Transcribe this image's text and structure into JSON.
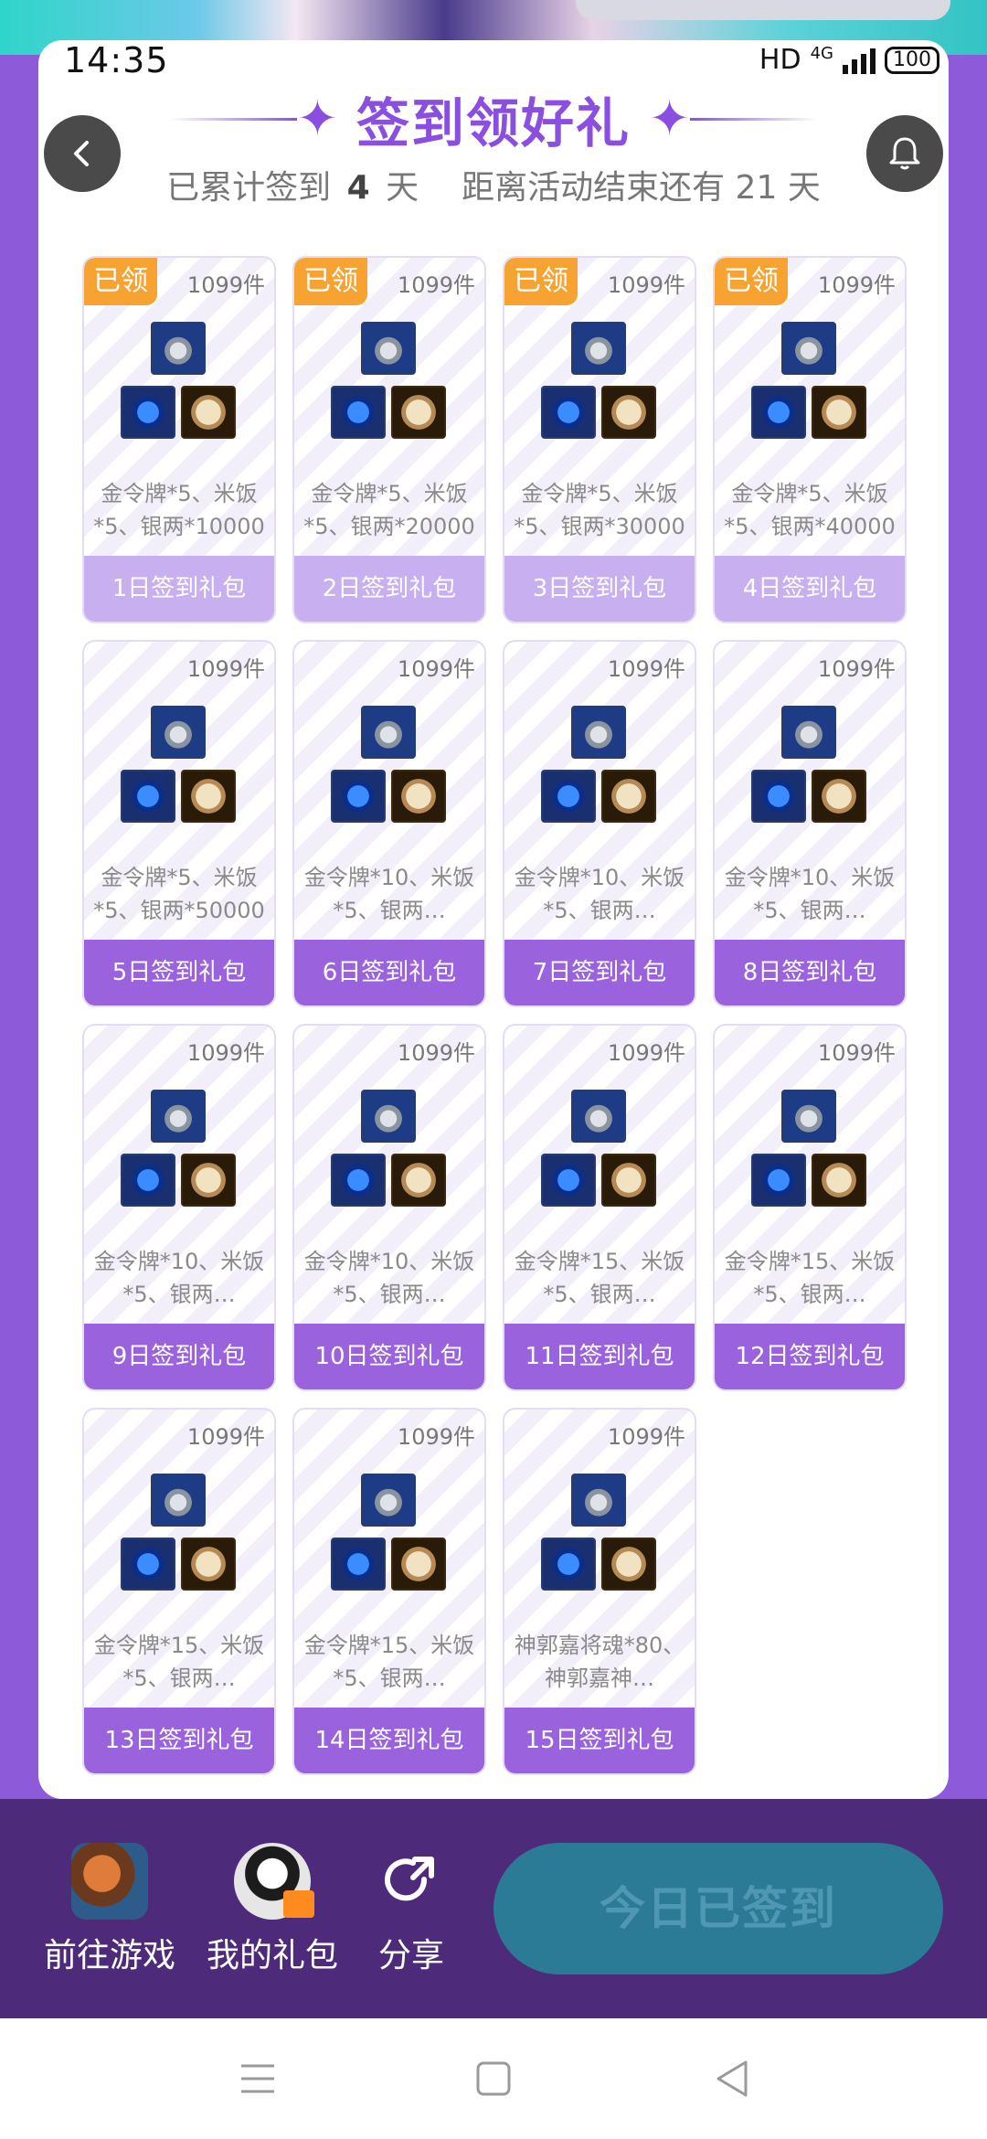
{
  "status_bar": {
    "time": "14:35",
    "network": "HD",
    "signal_type": "4G",
    "battery": "100"
  },
  "header": {
    "title": "签到领好礼",
    "subtitle_prefix": "已累计签到",
    "signed_days": "4",
    "day_unit": "天",
    "remaining_prefix": "距离活动结束还有",
    "remaining_days": "21",
    "remaining_unit": "天"
  },
  "claimed_label": "已领",
  "gifts": [
    {
      "count": "1099件",
      "desc": "金令牌*5、米饭*5、银两*10000",
      "label": "1日签到礼包",
      "claimed": true
    },
    {
      "count": "1099件",
      "desc": "金令牌*5、米饭*5、银两*20000",
      "label": "2日签到礼包",
      "claimed": true
    },
    {
      "count": "1099件",
      "desc": "金令牌*5、米饭*5、银两*30000",
      "label": "3日签到礼包",
      "claimed": true
    },
    {
      "count": "1099件",
      "desc": "金令牌*5、米饭*5、银两*40000",
      "label": "4日签到礼包",
      "claimed": true
    },
    {
      "count": "1099件",
      "desc": "金令牌*5、米饭*5、银两*50000",
      "label": "5日签到礼包",
      "claimed": false
    },
    {
      "count": "1099件",
      "desc": "金令牌*10、米饭*5、银两…",
      "label": "6日签到礼包",
      "claimed": false
    },
    {
      "count": "1099件",
      "desc": "金令牌*10、米饭*5、银两…",
      "label": "7日签到礼包",
      "claimed": false
    },
    {
      "count": "1099件",
      "desc": "金令牌*10、米饭*5、银两…",
      "label": "8日签到礼包",
      "claimed": false
    },
    {
      "count": "1099件",
      "desc": "金令牌*10、米饭*5、银两…",
      "label": "9日签到礼包",
      "claimed": false
    },
    {
      "count": "1099件",
      "desc": "金令牌*10、米饭*5、银两…",
      "label": "10日签到礼包",
      "claimed": false
    },
    {
      "count": "1099件",
      "desc": "金令牌*15、米饭*5、银两…",
      "label": "11日签到礼包",
      "claimed": false
    },
    {
      "count": "1099件",
      "desc": "金令牌*15、米饭*5、银两…",
      "label": "12日签到礼包",
      "claimed": false
    },
    {
      "count": "1099件",
      "desc": "金令牌*15、米饭*5、银两…",
      "label": "13日签到礼包",
      "claimed": false
    },
    {
      "count": "1099件",
      "desc": "金令牌*15、米饭*5、银两…",
      "label": "14日签到礼包",
      "claimed": false
    },
    {
      "count": "1099件",
      "desc": "神郭嘉将魂*80、神郭嘉神…",
      "label": "15日签到礼包",
      "claimed": false
    }
  ],
  "bottom": {
    "go_game": "前往游戏",
    "my_gifts": "我的礼包",
    "share": "分享",
    "signed_button": "今日已签到"
  },
  "colors": {
    "accent": "#8b4fe0",
    "claimed_tag": "#f6a331",
    "bottom_bar": "#4e2b7a",
    "signed_button": "#2c7b96"
  }
}
